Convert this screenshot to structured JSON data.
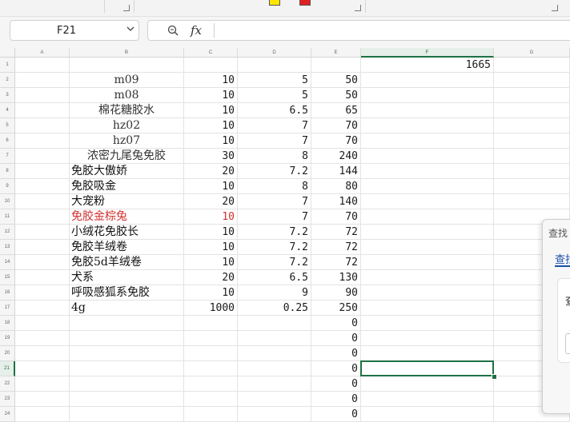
{
  "app": {
    "accent_color": "#1e7145",
    "highlight_red": "#d32f2f"
  },
  "ribbon": {
    "chips": [
      {
        "color": "#ffe600"
      },
      {
        "color": "#e02020"
      }
    ]
  },
  "formula_bar": {
    "name_box": "F21",
    "fx_label": "fx",
    "formula": "",
    "zoom_icon": "zoom-icon",
    "dropdown_icon": "chevron-down-icon"
  },
  "grid": {
    "columns": [
      "A",
      "B",
      "C",
      "D",
      "E",
      "F",
      "G"
    ],
    "selected_column": "F",
    "selected_row": "21",
    "row_numbers": [
      "1",
      "2",
      "3",
      "4",
      "5",
      "6",
      "7",
      "8",
      "9",
      "10",
      "11",
      "12",
      "13",
      "14",
      "15",
      "16",
      "17",
      "18",
      "19",
      "20",
      "21",
      "22",
      "23",
      "24"
    ],
    "cells": {
      "F1": "1665",
      "rows": [
        {
          "b": "",
          "c": "",
          "d": "",
          "e": ""
        },
        {
          "b": "m09",
          "c": "10",
          "d": "5",
          "e": "50"
        },
        {
          "b": "m08",
          "c": "10",
          "d": "5",
          "e": "50"
        },
        {
          "b": "棉花糖胶水",
          "c": "10",
          "d": "6.5",
          "e": "65"
        },
        {
          "b": "hz02",
          "c": "10",
          "d": "7",
          "e": "70"
        },
        {
          "b": "hz07",
          "c": "10",
          "d": "7",
          "e": "70"
        },
        {
          "b": "浓密九尾兔免胶",
          "c": "30",
          "d": "8",
          "e": "240"
        },
        {
          "b": "免胶大傲娇",
          "c": "20",
          "d": "7.2",
          "e": "144"
        },
        {
          "b": "免胶吸金",
          "c": "10",
          "d": "8",
          "e": "80"
        },
        {
          "b": "大宠粉",
          "c": "20",
          "d": "7",
          "e": "140"
        },
        {
          "b": "免胶金棕兔",
          "c": "10",
          "d": "7",
          "e": "70"
        },
        {
          "b": "小绒花免胶长",
          "c": "10",
          "d": "7.2",
          "e": "72"
        },
        {
          "b": "免胶羊绒卷",
          "c": "10",
          "d": "7.2",
          "e": "72"
        },
        {
          "b": "免胶5d羊绒卷",
          "c": "10",
          "d": "7.2",
          "e": "72"
        },
        {
          "b": "犬系",
          "c": "20",
          "d": "6.5",
          "e": "130"
        },
        {
          "b": "呼吸感狐系免胶",
          "c": "10",
          "d": "9",
          "e": "90"
        },
        {
          "b": "4g",
          "c": "1000",
          "d": "0.25",
          "e": "250"
        },
        {
          "b": "",
          "c": "",
          "d": "",
          "e": "0"
        },
        {
          "b": "",
          "c": "",
          "d": "",
          "e": "0"
        },
        {
          "b": "",
          "c": "",
          "d": "",
          "e": "0"
        },
        {
          "b": "",
          "c": "",
          "d": "",
          "e": "0"
        },
        {
          "b": "",
          "c": "",
          "d": "",
          "e": "0"
        },
        {
          "b": "",
          "c": "",
          "d": "",
          "e": "0"
        },
        {
          "b": "",
          "c": "",
          "d": "",
          "e": "0"
        }
      ]
    }
  },
  "find_dialog": {
    "title": "查找",
    "tab_label": "查找",
    "field_label": "查"
  }
}
